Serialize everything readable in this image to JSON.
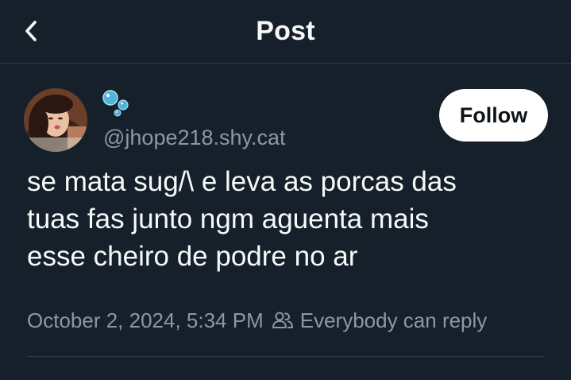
{
  "header": {
    "title": "Post",
    "back_icon": "chevron-left-icon"
  },
  "author": {
    "name_emoji": "bubbles-emoji",
    "handle": "@jhope218.shy.cat"
  },
  "follow_label": "Follow",
  "post": {
    "lines": [
      "se mata sug/\\ e leva as porcas das",
      "tuas fas junto ngm aguenta mais",
      "esse cheiro de podre no ar"
    ]
  },
  "meta": {
    "timestamp": "October 2, 2024, 5:34 PM",
    "reply_icon": "people-icon",
    "reply_scope": "Everybody can reply"
  },
  "colors": {
    "background": "#15202b",
    "text": "#f7f9f9",
    "secondary_text": "#8b98a5",
    "follow_button_bg": "#ffffff",
    "divider": "#2f3b47"
  }
}
